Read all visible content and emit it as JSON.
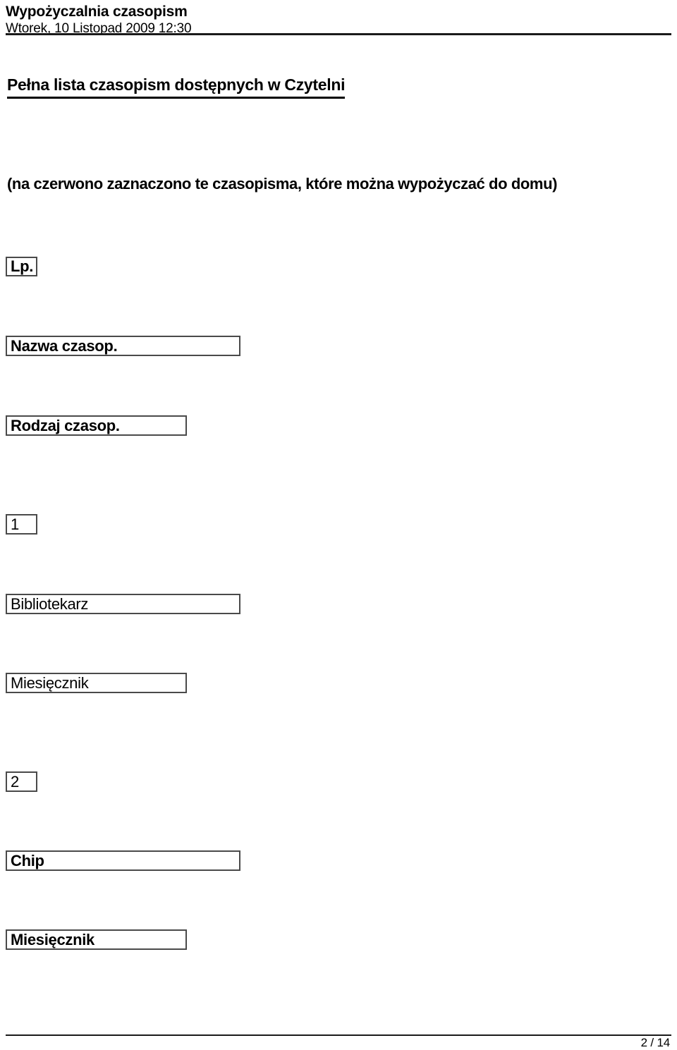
{
  "header": {
    "title": "Wypożyczalnia czasopism",
    "date": "Wtorek, 10 Listopad 2009 12:30"
  },
  "section": {
    "title": "Pełna lista czasopism dostępnych w Czytelni",
    "note": "(na czerwono zaznaczono te czasopisma, które można wypożyczać do domu)"
  },
  "table": {
    "columns": [
      {
        "key": "lp",
        "label": "Lp."
      },
      {
        "key": "name",
        "label": "Nazwa czasop."
      },
      {
        "key": "kind",
        "label": "Rodzaj czasop."
      }
    ],
    "rows": [
      {
        "lp": "1",
        "name": "Bibliotekarz",
        "kind": "Miesięcznik",
        "borrowable": false
      },
      {
        "lp": "2",
        "name": "Chip",
        "kind": "Miesięcznik",
        "borrowable": true
      }
    ]
  },
  "footer": {
    "pages": "2 / 14"
  },
  "colors": {
    "text": "#000000",
    "rule": "#1a1a1a",
    "cell_border": "#4a4a4a",
    "background": "#ffffff"
  }
}
